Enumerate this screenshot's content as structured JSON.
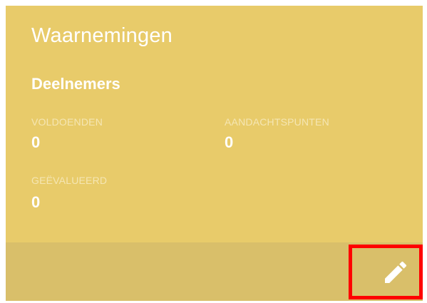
{
  "card": {
    "title": "Waarnemingen",
    "subtitle": "Deelnemers",
    "stats": [
      {
        "label": "VOLDOENDEN",
        "value": "0"
      },
      {
        "label": "AANDACHTSPUNTEN",
        "value": "0"
      },
      {
        "label": "GEËVALUEERD",
        "value": "0"
      }
    ]
  },
  "footer": {
    "edit_icon": "pencil-icon",
    "highlight_color": "#ff0000"
  },
  "colors": {
    "card_background": "#e8cb6a",
    "footer_background": "#d9bf6a",
    "text": "#ffffff"
  }
}
